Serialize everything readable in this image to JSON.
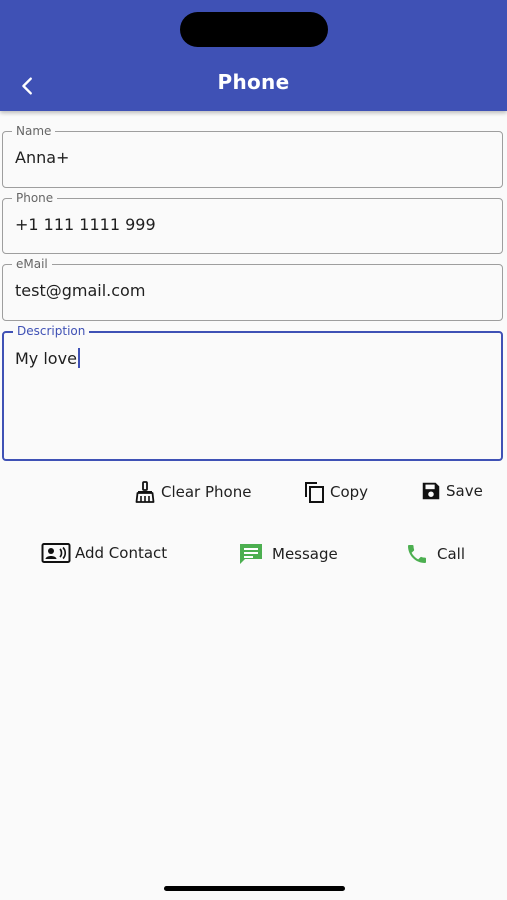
{
  "header": {
    "title": "Phone",
    "background": "#3f51b5"
  },
  "form": {
    "name": {
      "label": "Name",
      "value": "Anna+"
    },
    "phone": {
      "label": "Phone",
      "value": "+1 111 1111 999"
    },
    "email": {
      "label": "eMail",
      "value": "test@gmail.com"
    },
    "description": {
      "label": "Description",
      "value": "My love"
    }
  },
  "actions": {
    "clear_phone": {
      "label": "Clear Phone",
      "icon": "broom-icon"
    },
    "copy": {
      "label": "Copy",
      "icon": "copy-icon"
    },
    "save": {
      "label": "Save",
      "icon": "save-icon"
    },
    "add_contact": {
      "label": "Add Contact",
      "icon": "contact-card-icon"
    },
    "message": {
      "label": "Message",
      "icon": "message-icon",
      "color": "#4caf50"
    },
    "call": {
      "label": "Call",
      "icon": "phone-icon",
      "color": "#4caf50"
    }
  },
  "colors": {
    "accent": "#3f51b5",
    "green": "#4caf50"
  }
}
